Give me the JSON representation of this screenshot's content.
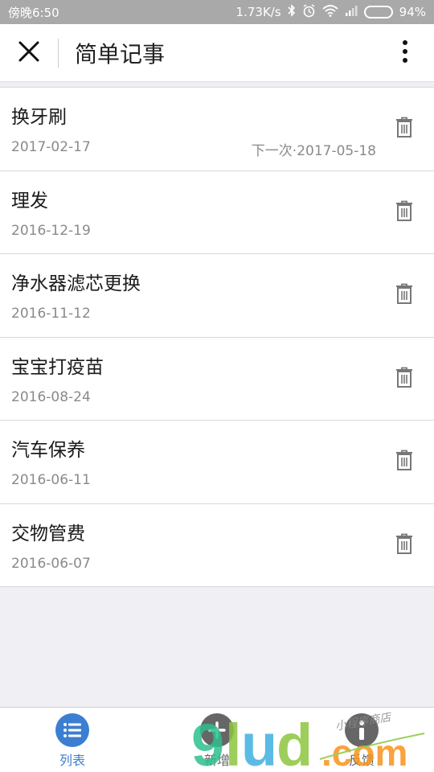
{
  "status_bar": {
    "time": "傍晚6:50",
    "network_speed": "1.73K/s",
    "battery": "94%",
    "battery_level": 0.94
  },
  "header": {
    "title": "简单记事"
  },
  "items": [
    {
      "title": "换牙刷",
      "date": "2017-02-17",
      "next": "下一次·2017-05-18"
    },
    {
      "title": "理发",
      "date": "2016-12-19",
      "next": ""
    },
    {
      "title": "净水器滤芯更换",
      "date": "2016-11-12",
      "next": ""
    },
    {
      "title": "宝宝打疫苗",
      "date": "2016-08-24",
      "next": ""
    },
    {
      "title": "汽车保养",
      "date": "2016-06-11",
      "next": ""
    },
    {
      "title": "交物管费",
      "date": "2016-06-07",
      "next": ""
    }
  ],
  "tabs": [
    {
      "label": "列表",
      "icon": "list-icon",
      "active": true
    },
    {
      "label": "新增",
      "icon": "plus-icon",
      "active": false
    },
    {
      "label": "反馈",
      "icon": "info-icon",
      "active": false
    }
  ],
  "watermark": {
    "text": "9lud.com",
    "sub": "小程序商店"
  },
  "colors": {
    "accent": "#3c7fd1",
    "status_bar": "#a9a9a9",
    "background": "#efeff4"
  }
}
